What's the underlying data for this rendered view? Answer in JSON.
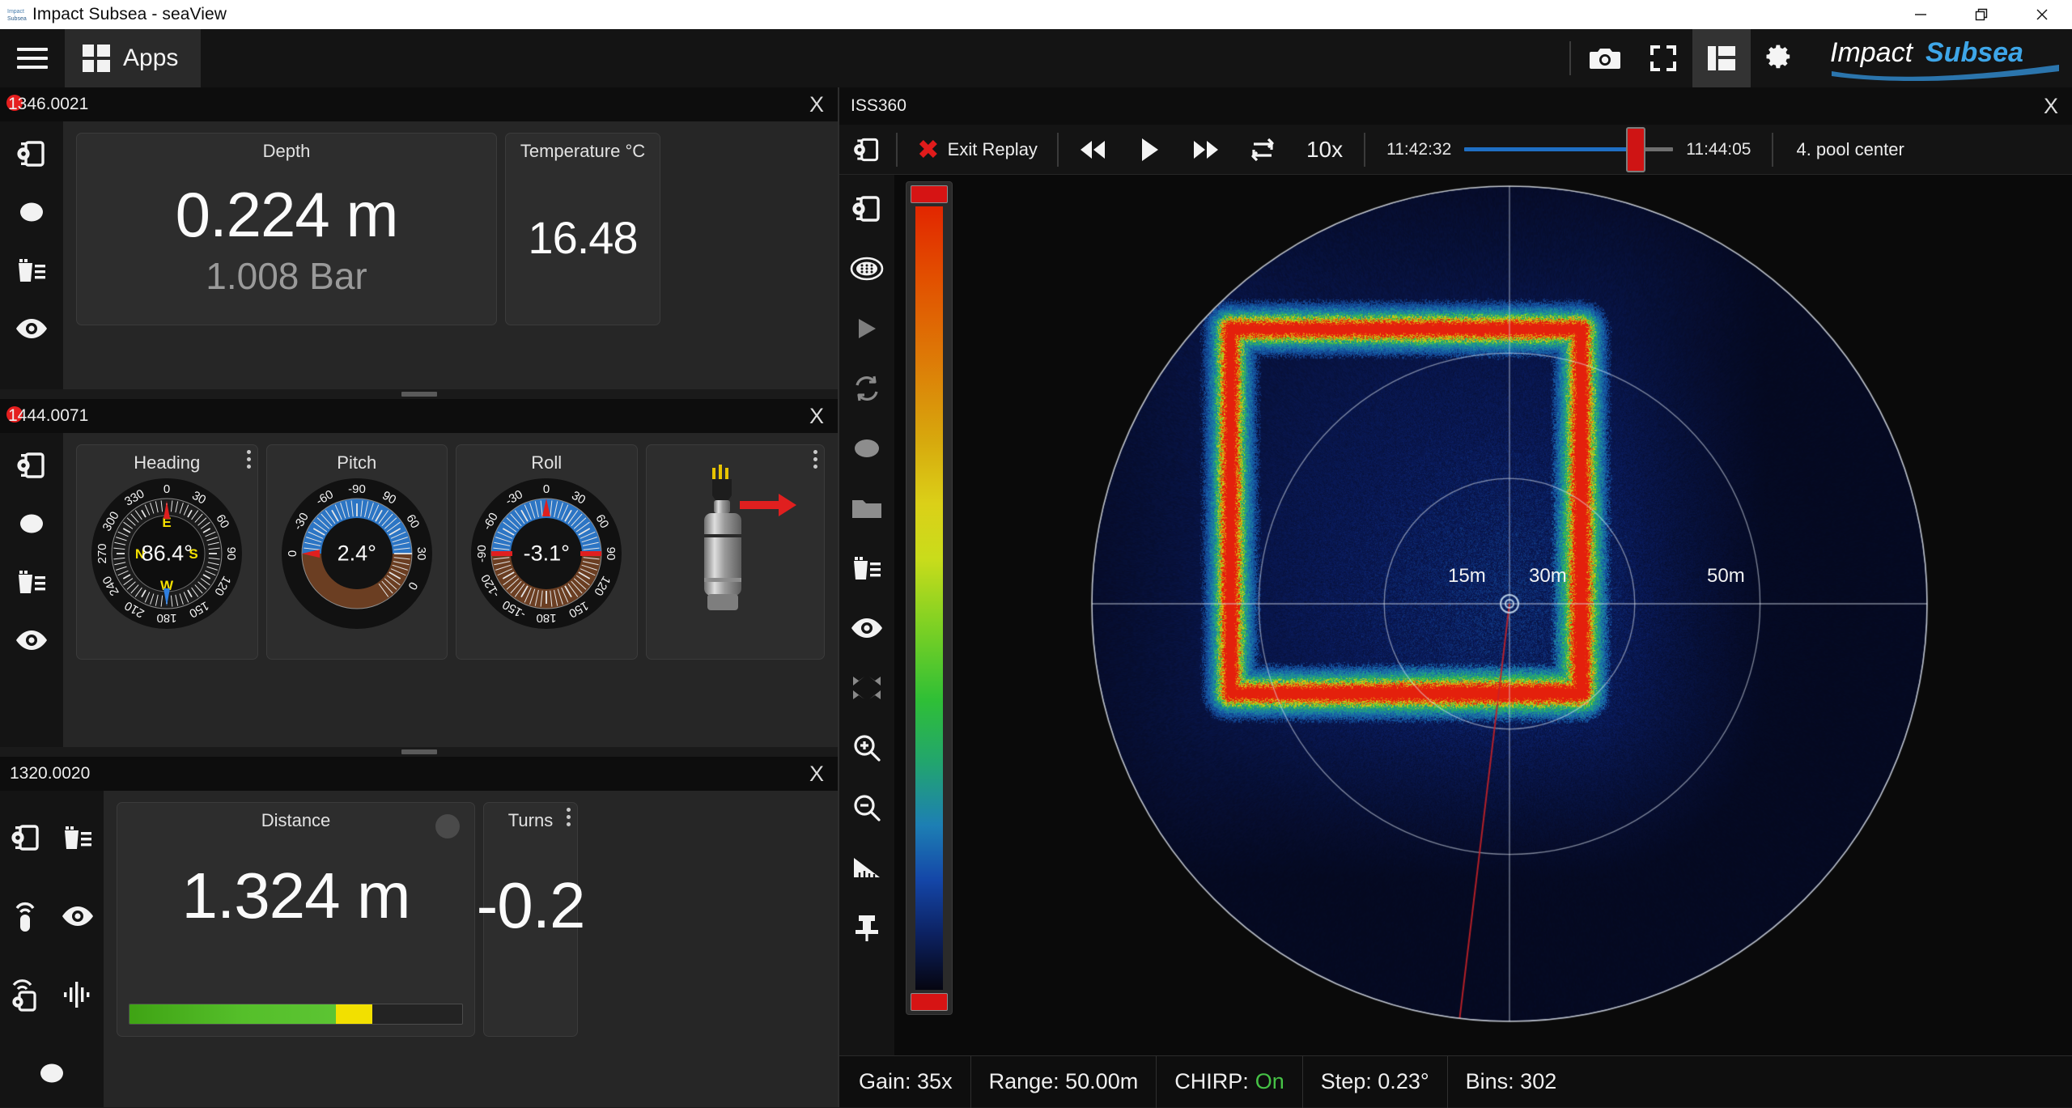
{
  "window": {
    "title": "Impact Subsea - seaView",
    "controls": {
      "minimize": "minimize-button",
      "restore": "restore-button",
      "close": "close-button"
    }
  },
  "menubar": {
    "hamburger": "hamburger-menu",
    "apps_label": "Apps",
    "tools": [
      "camera-icon",
      "fullscreen-icon",
      "layout-icon",
      "gear-icon"
    ],
    "brand": {
      "part1": "Impact",
      "part2": "Subsea"
    }
  },
  "panels": [
    {
      "id": "panel-depth",
      "title": "1346.0021",
      "recording": true,
      "close_label": "X",
      "tools": [
        "device-settings-icon",
        "record-icon",
        "delete-log-icon",
        "eye-icon"
      ],
      "cards": [
        {
          "name": "depth",
          "title": "Depth",
          "value": "0.224 m",
          "sub": "1.008 Bar"
        },
        {
          "name": "temperature",
          "title": "Temperature °C",
          "value": "16.48"
        }
      ]
    },
    {
      "id": "panel-ahrs",
      "title": "1444.0071",
      "recording": true,
      "close_label": "X",
      "tools": [
        "device-settings-icon",
        "record-icon",
        "delete-log-icon",
        "eye-icon"
      ],
      "gauges": [
        {
          "name": "heading",
          "title": "Heading",
          "value": "86.4°",
          "ticks": [
            "0",
            "30",
            "60",
            "90",
            "120",
            "150",
            "180",
            "210",
            "240",
            "270",
            "300",
            "330"
          ],
          "cardinals": [
            "N",
            "E",
            "S",
            "W"
          ],
          "kebab": true
        },
        {
          "name": "pitch",
          "title": "Pitch",
          "value": "2.4°",
          "ticks": [
            "0",
            "-30",
            "-60",
            "-90",
            "90",
            "60",
            "30"
          ],
          "kebab": false
        },
        {
          "name": "roll",
          "title": "Roll",
          "value": "-3.1°",
          "ticks": [
            "0",
            "30",
            "60",
            "90",
            "120",
            "150",
            "180",
            "-150",
            "-120",
            "-90",
            "-60",
            "-30"
          ],
          "kebab": false
        }
      ],
      "sensor_card": {
        "name": "sensor-orientation",
        "kebab": true,
        "icon": "subsea-sensor-icon"
      }
    },
    {
      "id": "panel-distance",
      "title": "1320.0020",
      "recording": false,
      "close_label": "X",
      "tools": [
        "device-settings-icon",
        "delete-log-icon",
        "sensor-icon",
        "eye-icon",
        "sensor-settings-icon",
        "waveform-icon",
        "record-icon"
      ],
      "cards": [
        {
          "name": "distance",
          "title": "Distance",
          "value": "1.324 m",
          "led": true,
          "progress": {
            "green_pct": 62,
            "yellow_pct": 11
          }
        },
        {
          "name": "turns",
          "title": "Turns",
          "value": "-0.2",
          "kebab": true
        }
      ]
    }
  ],
  "sonar": {
    "title": "ISS360",
    "close_label": "X",
    "replay": {
      "settings_icon": "device-settings-icon",
      "exit_label": "Exit Replay",
      "exit_icon": "close-x-icon",
      "rewind_icon": "rewind-icon",
      "play_icon": "play-icon",
      "forward_icon": "fast-forward-icon",
      "loop_icon": "loop-icon",
      "speed": "10x",
      "start_time": "11:42:32",
      "end_time": "11:44:05",
      "position_pct": 82,
      "marker_label": "4. pool center"
    },
    "tools": [
      "device-settings-icon",
      "sonar-head-icon",
      "play-icon",
      "refresh-icon",
      "record-icon",
      "folder-icon",
      "delete-log-icon",
      "eye-icon",
      "expand-icon",
      "zoom-in-icon",
      "zoom-out-icon",
      "measure-icon",
      "pin-icon"
    ],
    "colorbar": {
      "top_handle": "gain-max-handle",
      "bottom_handle": "gain-min-handle"
    },
    "range_labels": [
      "15m",
      "30m",
      "50m"
    ],
    "status": [
      {
        "name": "gain",
        "label": "Gain: 35x"
      },
      {
        "name": "range",
        "label": "Range: 50.00m"
      },
      {
        "name": "chirp",
        "label": "CHIRP:",
        "value": "On",
        "value_color": "#46c246"
      },
      {
        "name": "step",
        "label": "Step: 0.23°"
      },
      {
        "name": "bins",
        "label": "Bins: 302"
      }
    ]
  }
}
